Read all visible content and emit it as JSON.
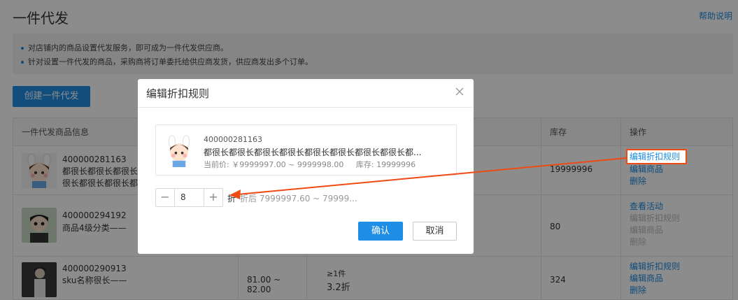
{
  "page": {
    "title": "一件代发",
    "help": "帮助说明",
    "notices": [
      "对店铺内的商品设置代发服务，即可成为一件代发供应商。",
      "针对设置一件代发的商品，采购商将订单委托给供应商发货，供应商发出多个订单。"
    ],
    "create_button": "创建一件代发"
  },
  "table": {
    "headers": [
      "一件代发商品信息",
      "库存",
      "操作"
    ],
    "rows": [
      {
        "id": "400000281163",
        "name_line1": "都很长都很长都很长",
        "name_line2": "很长都很长都很长都",
        "stock": "19999996",
        "ops": [
          "编辑折扣规则",
          "编辑商品",
          "删除"
        ]
      },
      {
        "id": "400000294192",
        "name_line1": "商品4级分类——",
        "stock": "80",
        "ops": [
          "查看活动",
          "编辑折扣规则",
          "编辑商品",
          "删除"
        ]
      },
      {
        "id": "400000290913",
        "name_line1": "sku名称很长——",
        "price": "81.00 ~ 82.00",
        "discount_cond": "≥1件",
        "discount_val": "3.2折",
        "stock": "324",
        "ops": [
          "编辑折扣规则",
          "编辑商品",
          "删除"
        ]
      }
    ]
  },
  "dialog": {
    "title": "编辑折扣规则",
    "product": {
      "id": "400000281163",
      "name": "都很长都很长都很长都很长都很长都很长都很长都很长都...",
      "price_label": "当前价: ￥9999997.00 ~ 9999998.00",
      "stock_label": "库存: 19999996"
    },
    "discount_value": "8",
    "unit": "折",
    "after_price": "折后 7999997.60 ~ 79999...",
    "confirm": "确认",
    "cancel": "取消"
  },
  "colors": {
    "accent": "#1f8ee6",
    "link": "#1a8be0",
    "annotation": "#f04a14"
  }
}
